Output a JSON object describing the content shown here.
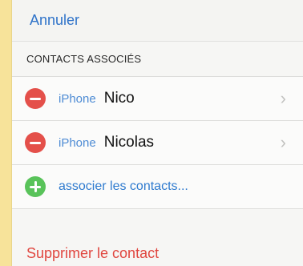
{
  "topbar": {
    "cancel_label": "Annuler"
  },
  "section": {
    "title": "CONTACTS ASSOCIÉS"
  },
  "linked_contacts": [
    {
      "source": "iPhone",
      "name": "Nico",
      "chevron": "›"
    },
    {
      "source": "iPhone",
      "name": "Nicolas",
      "chevron": "›"
    }
  ],
  "add_link": {
    "label": "associer les contacts..."
  },
  "delete": {
    "label": "Supprimer le contact"
  },
  "icons": {
    "remove": "minus-circle-icon",
    "add": "plus-circle-icon",
    "chevron": "chevron-right-icon"
  },
  "colors": {
    "accent_blue": "#2f73c9",
    "destructive_red": "#e0463f",
    "remove_badge": "#e4504a",
    "add_badge": "#59c35a",
    "background_yellow": "#f7e39a"
  }
}
